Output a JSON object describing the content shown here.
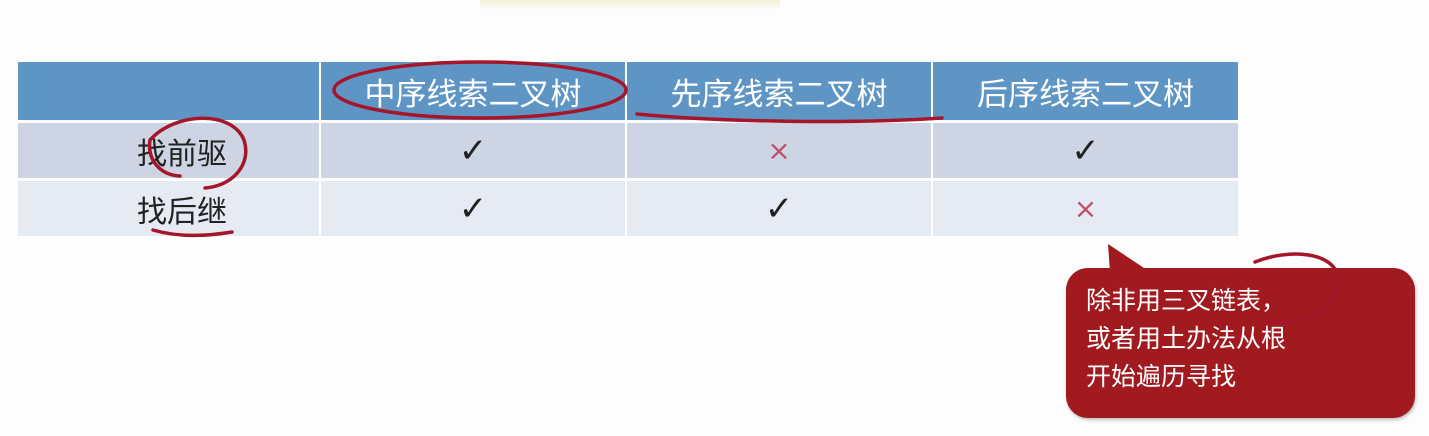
{
  "table": {
    "headers": [
      "",
      "中序线索二叉树",
      "先序线索二叉树",
      "后序线索二叉树"
    ],
    "rows": [
      {
        "label": "找前驱",
        "cells": [
          "✓",
          "×",
          "✓"
        ]
      },
      {
        "label": "找后继",
        "cells": [
          "✓",
          "✓",
          "×"
        ]
      }
    ]
  },
  "callout": {
    "text": "除非用三叉链表，\n或者用土办法从根\n开始遍历寻找"
  },
  "colors": {
    "header_bg": "#5f95c4",
    "row_odd_bg": "#cdd5e4",
    "row_even_bg": "#e6eaf2",
    "cross_mark": "#c0506a",
    "callout_bg": "#a01a20",
    "ink": "#a5162a"
  }
}
